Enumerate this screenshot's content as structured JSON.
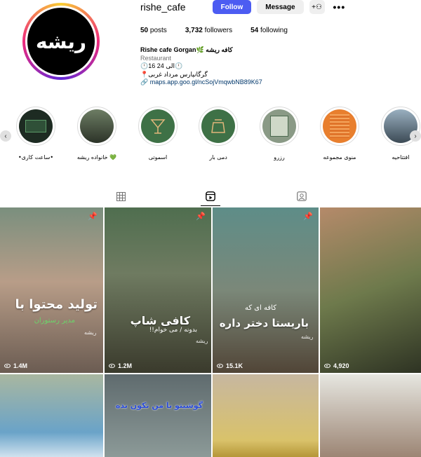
{
  "profile": {
    "username": "rishe_cafe",
    "avatar_text": "ریشه",
    "follow_label": "Follow",
    "message_label": "Message",
    "suggest_icon": "person-add-icon",
    "more_icon": "more-horizontal-icon",
    "stats": {
      "posts_count": "50",
      "posts_label": " posts",
      "followers_count": "3,732",
      "followers_label": " followers",
      "following_count": "54",
      "following_label": " following"
    },
    "bio": {
      "name": "Rishe cafe Gorgan🌿 کافه ریشه",
      "category": "Restaurant",
      "hours": "🕛16 الی 24🕛",
      "address": "📍گرگانپارس مرداد غربی",
      "link": "maps.app.goo.gl/ncSojVmqwbNB89K67"
    }
  },
  "highlights": [
    {
      "label": "•ساعت کاری•"
    },
    {
      "label": "خانواده ریشه 💚"
    },
    {
      "label": "اسموتی"
    },
    {
      "label": "دمی بار"
    },
    {
      "label": "رزرو"
    },
    {
      "label": "منوی مجموعه"
    },
    {
      "label": "افتتاحیه"
    }
  ],
  "tabs": {
    "posts_icon": "grid-icon",
    "reels_icon": "reels-icon",
    "tagged_icon": "tagged-icon"
  },
  "posts": [
    {
      "views": "1.4M",
      "title": "تولید محتوا با",
      "subtitle": "مدیر رستوران",
      "brand": "ریشه",
      "pinned": true
    },
    {
      "views": "1.2M",
      "title": "کافی شاپ",
      "subtitle": "بدونه / می خوام!!",
      "brand": "ریشه",
      "pinned": true
    },
    {
      "views": "15.1K",
      "title": "باریستا دختر داره",
      "subtitle": "کافه ای که",
      "brand": "ریشه",
      "pinned": true
    },
    {
      "views": "4,920",
      "title": "",
      "subtitle": "",
      "brand": "",
      "pinned": false
    },
    {
      "views": "",
      "title": "",
      "subtitle": "",
      "brand": "",
      "pinned": false
    },
    {
      "views": "",
      "title": "گوشیتو با من تکون بده",
      "subtitle": "",
      "brand": "",
      "pinned": false
    },
    {
      "views": "",
      "title": "",
      "subtitle": "",
      "brand": "",
      "pinned": false
    },
    {
      "views": "",
      "title": "",
      "subtitle": "",
      "brand": "",
      "pinned": false
    }
  ]
}
